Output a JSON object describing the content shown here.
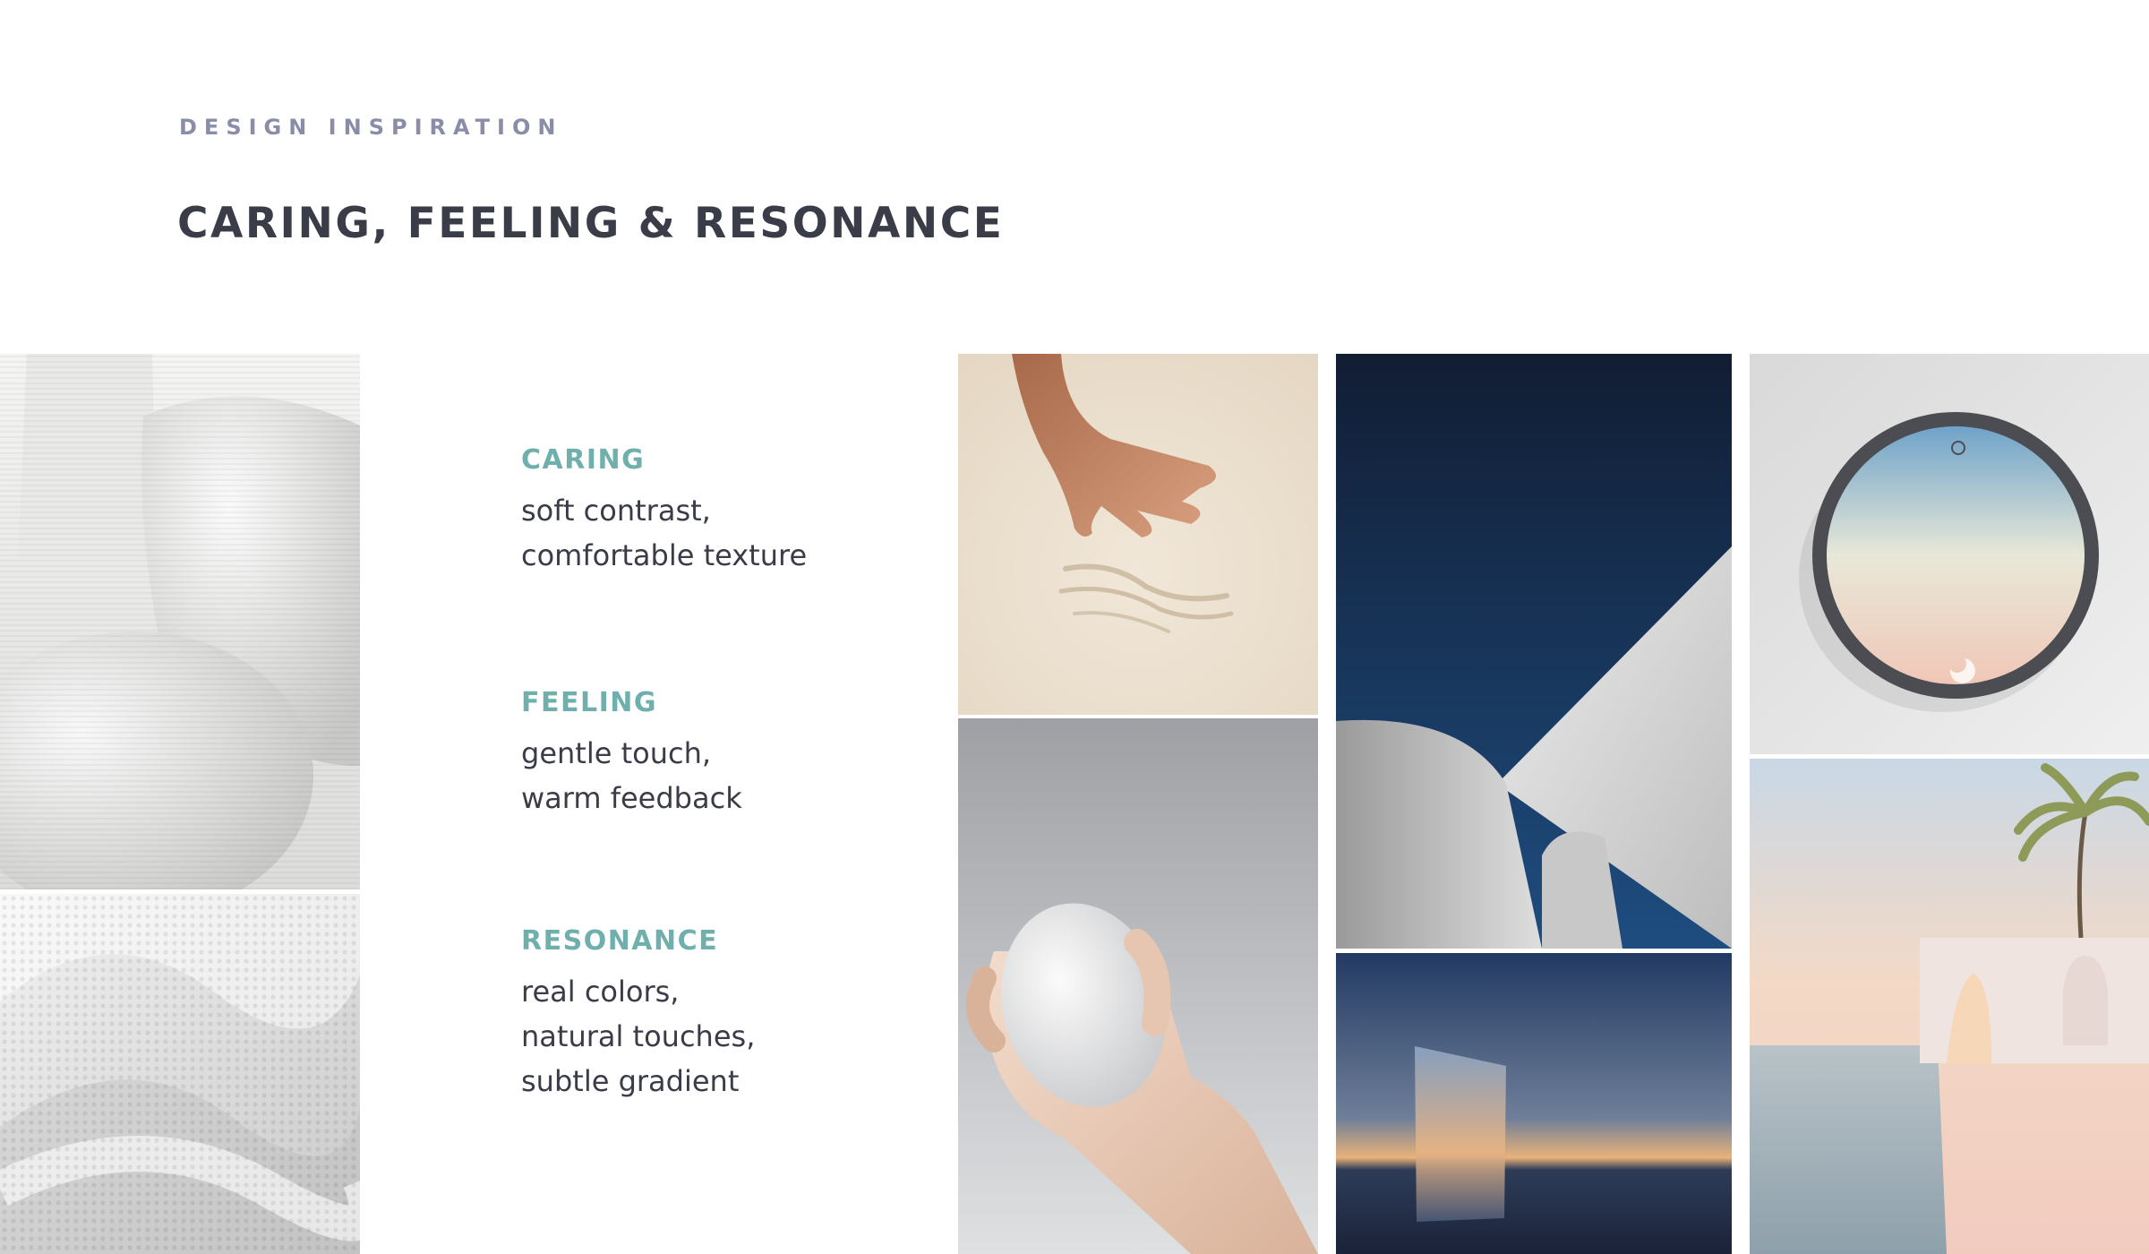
{
  "header": {
    "eyebrow": "DESIGN INSPIRATION",
    "title": "CARING, FEELING & RESONANCE"
  },
  "concepts": [
    {
      "heading": "CARING",
      "lines": [
        "soft contrast,",
        "comfortable texture"
      ]
    },
    {
      "heading": "FEELING",
      "lines": [
        "gentle touch,",
        "warm feedback"
      ]
    },
    {
      "heading": "RESONANCE",
      "lines": [
        "real colors,",
        "natural touches,",
        "subtle gradient"
      ]
    }
  ],
  "colors": {
    "accent": "#6fafac",
    "heading": "#3a3c48",
    "eyebrow": "#8a8da8",
    "background": "#ffffff"
  },
  "tiles": [
    {
      "name": "white-ribbed-vessels-photo",
      "icon": "photo"
    },
    {
      "name": "white-knit-texture-photo",
      "icon": "photo"
    },
    {
      "name": "hand-on-sand-photo",
      "icon": "photo"
    },
    {
      "name": "hand-holding-pebble-photo",
      "icon": "photo"
    },
    {
      "name": "white-curved-architecture-photo",
      "icon": "photo"
    },
    {
      "name": "mirror-sunset-sea-photo",
      "icon": "photo"
    },
    {
      "name": "round-gradient-device-photo",
      "icon": "photo"
    },
    {
      "name": "pastel-pool-palm-photo",
      "icon": "photo"
    }
  ]
}
